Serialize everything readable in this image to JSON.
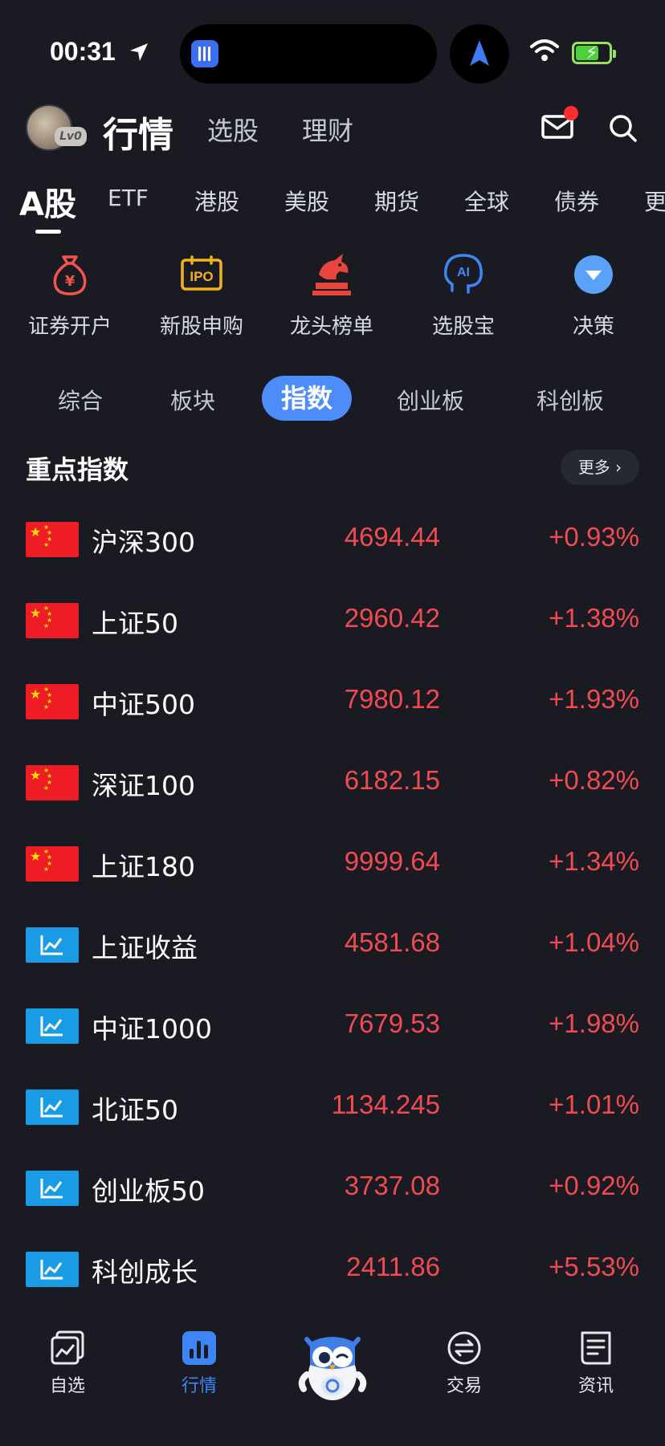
{
  "status": {
    "time": "00:31"
  },
  "header": {
    "avatar_level": "Lv0",
    "tabs": [
      "行情",
      "选股",
      "理财"
    ]
  },
  "market_tabs": [
    "A股",
    "ETF",
    "港股",
    "美股",
    "期货",
    "全球",
    "债券",
    "更"
  ],
  "shortcuts": [
    {
      "label": "证券开户",
      "icon": "money-bag-icon"
    },
    {
      "label": "新股申购",
      "icon": "ipo-icon"
    },
    {
      "label": "龙头榜单",
      "icon": "dragon-icon"
    },
    {
      "label": "选股宝",
      "icon": "ai-head-icon"
    },
    {
      "label": "决策",
      "icon": "dropdown-circle-icon"
    }
  ],
  "subtabs": [
    "综合",
    "板块",
    "指数",
    "创业板",
    "科创板"
  ],
  "section": {
    "title": "重点指数",
    "more": "更多 ›"
  },
  "indices": [
    {
      "name": "沪深300",
      "price": "4694.44",
      "change": "+0.93%",
      "icon": "china-flag-icon"
    },
    {
      "name": "上证50",
      "price": "2960.42",
      "change": "+1.38%",
      "icon": "china-flag-icon"
    },
    {
      "name": "中证500",
      "price": "7980.12",
      "change": "+1.93%",
      "icon": "china-flag-icon"
    },
    {
      "name": "深证100",
      "price": "6182.15",
      "change": "+0.82%",
      "icon": "china-flag-icon"
    },
    {
      "name": "上证180",
      "price": "9999.64",
      "change": "+1.34%",
      "icon": "china-flag-icon"
    },
    {
      "name": "上证收益",
      "price": "4581.68",
      "change": "+1.04%",
      "icon": "line-chart-icon"
    },
    {
      "name": "中证1000",
      "price": "7679.53",
      "change": "+1.98%",
      "icon": "line-chart-icon"
    },
    {
      "name": "北证50",
      "price": "1134.245",
      "change": "+1.01%",
      "icon": "line-chart-icon"
    },
    {
      "name": "创业板50",
      "price": "3737.08",
      "change": "+0.92%",
      "icon": "line-chart-icon"
    },
    {
      "name": "科创成长",
      "price": "2411.86",
      "change": "+5.53%",
      "icon": "line-chart-icon"
    }
  ],
  "bottom_nav": [
    "自选",
    "行情",
    "交易",
    "资讯"
  ],
  "colors": {
    "up": "#f14a52",
    "accent": "#4d8dfa",
    "background": "#1a1b22"
  }
}
